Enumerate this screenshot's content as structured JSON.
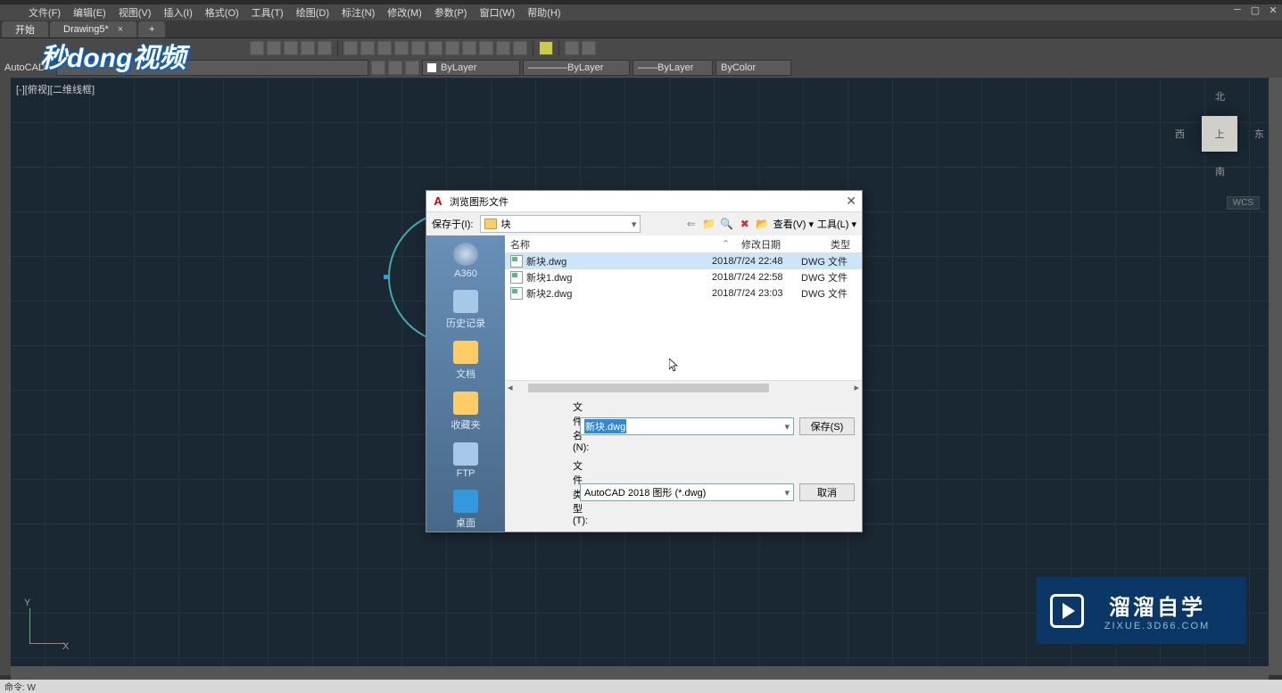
{
  "menubar": {
    "items": [
      "文件(F)",
      "编辑(E)",
      "视图(V)",
      "插入(I)",
      "格式(O)",
      "工具(T)",
      "绘图(D)",
      "标注(N)",
      "修改(M)",
      "参数(P)",
      "窗口(W)",
      "帮助(H)"
    ]
  },
  "tabs": {
    "start": "开始",
    "drawing": "Drawing5*",
    "add": "+"
  },
  "layer": {
    "label": "AutoCAD",
    "bylayer": "ByLayer",
    "bycolor": "ByColor"
  },
  "viewport": "[-][俯视][二维线框]",
  "viewcube": {
    "n": "北",
    "s": "南",
    "w": "西",
    "e": "东",
    "top": "上",
    "wcs": "WCS"
  },
  "ucs": {
    "x": "X",
    "y": "Y"
  },
  "cmd": "命令: W",
  "overlay_logo": "秒dong视频",
  "logo2": {
    "top": "溜溜自学",
    "bot": "ZIXUE.3D66.COM"
  },
  "dialog": {
    "title": "浏览图形文件",
    "savein_label": "保存于(I):",
    "folder": "块",
    "view_label": "查看(V)",
    "tools_label": "工具(L)",
    "places": [
      "A360",
      "历史记录",
      "文档",
      "收藏夹",
      "FTP",
      "桌面"
    ],
    "columns": {
      "name": "名称",
      "date": "修改日期",
      "type": "类型"
    },
    "files": [
      {
        "name": "新块.dwg",
        "date": "2018/7/24 22:48",
        "type": "DWG 文件"
      },
      {
        "name": "新块1.dwg",
        "date": "2018/7/24 22:58",
        "type": "DWG 文件"
      },
      {
        "name": "新块2.dwg",
        "date": "2018/7/24 23:03",
        "type": "DWG 文件"
      }
    ],
    "filename_label": "文件名(N):",
    "filename_value": "新块.dwg",
    "filetype_label": "文件类型(T):",
    "filetype_value": "AutoCAD 2018 图形 (*.dwg)",
    "save_btn": "保存(S)",
    "cancel_btn": "取消"
  }
}
